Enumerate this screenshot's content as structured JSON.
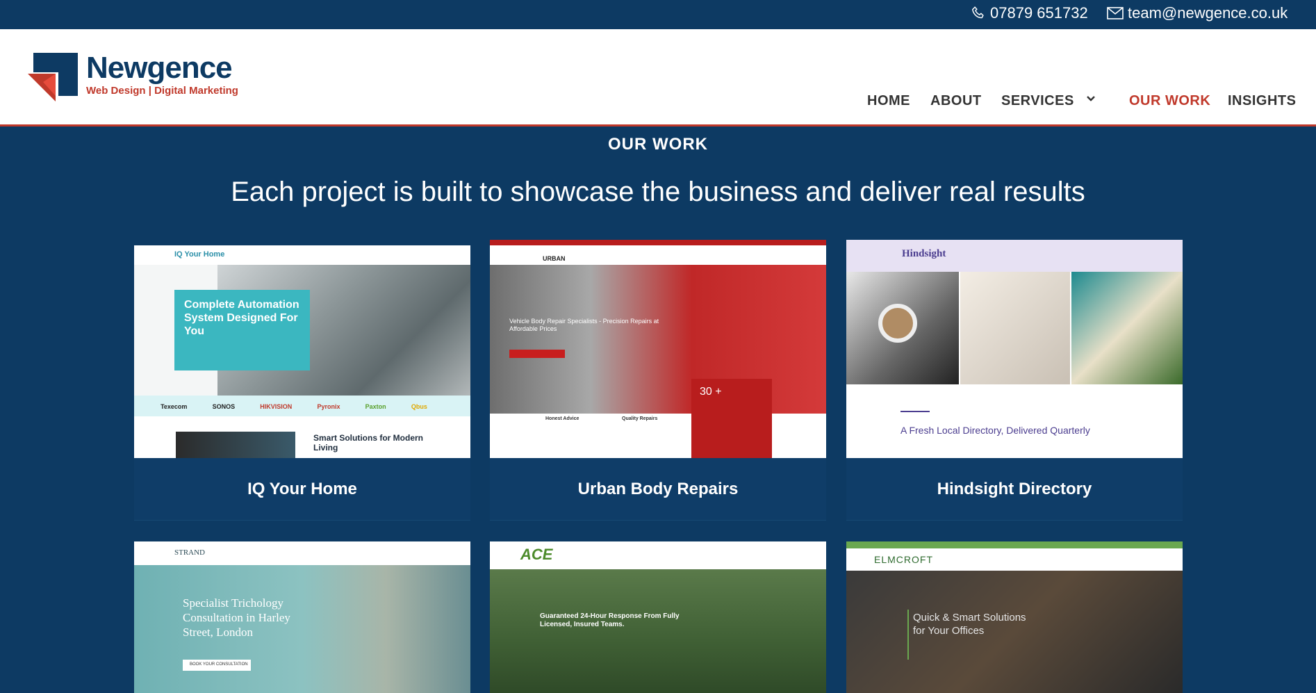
{
  "topbar": {
    "phone": "07879 651732",
    "email": "team@newgence.co.uk"
  },
  "logo": {
    "name": "Newgence",
    "tagline": "Web Design | Digital Marketing"
  },
  "nav": {
    "home": "HOME",
    "about": "ABOUT",
    "services": "SERVICES",
    "our_work": "OUR WORK",
    "insights": "INSIGHTS"
  },
  "colors": {
    "navy": "#0d3a63",
    "accent_red": "#c0392b"
  },
  "section": {
    "label": "OUR WORK",
    "headline": "Each project is built to showcase the business and deliver real results"
  },
  "projects": [
    {
      "title": "IQ Your Home",
      "site_name": "IQ Your Home",
      "hero": "Complete Automation System Designed For You",
      "brands": [
        "Texecom",
        "SONOS",
        "HIKVISION",
        "Pyronix",
        "Paxton",
        "Qbus"
      ],
      "subhead": "Smart Solutions for Modern Living"
    },
    {
      "title": "Urban Body Repairs",
      "site_name": "URBAN",
      "hero": "Vehicle Body Repair Specialists - Precision Repairs at Affordable Prices",
      "stat": "30 +",
      "feature_1": "Honest Advice",
      "feature_2": "Quality Repairs"
    },
    {
      "title": "Hindsight Directory",
      "site_name": "Hindsight",
      "hero": "A Fresh Local Directory, Delivered Quarterly"
    },
    {
      "site_name": "STRAND",
      "hero": "Specialist Trichology Consultation in Harley Street, London",
      "cta": "BOOK YOUR CONSULTATION"
    },
    {
      "site_name": "ACE",
      "hero": "Guaranteed 24-Hour Response From Fully Licensed, Insured Teams."
    },
    {
      "site_name": "ELMCROFT",
      "hero": "Quick & Smart Solutions for Your Offices"
    }
  ]
}
